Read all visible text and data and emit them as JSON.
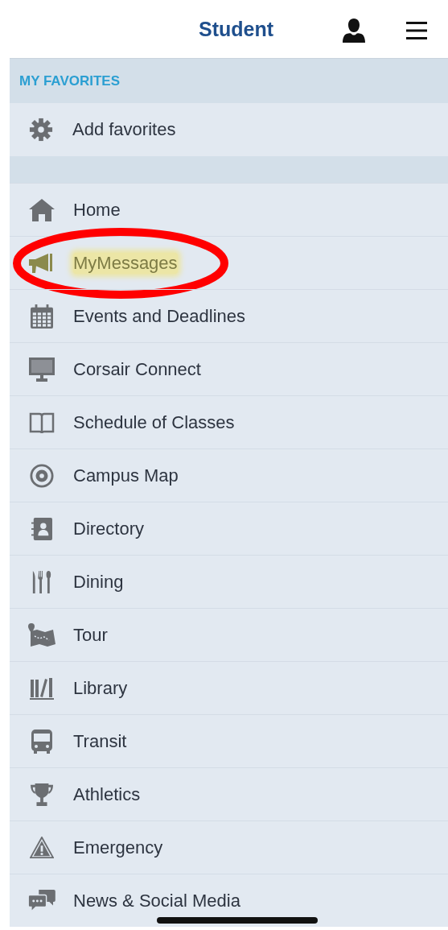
{
  "header": {
    "title": "Student"
  },
  "favorites": {
    "heading": "MY FAVORITES",
    "items": [
      {
        "label": "Add favorites"
      }
    ]
  },
  "menu": [
    {
      "label": "Home",
      "highlighted": false
    },
    {
      "label": "MyMessages",
      "highlighted": true
    },
    {
      "label": "Events and Deadlines",
      "highlighted": false
    },
    {
      "label": "Corsair Connect",
      "highlighted": false
    },
    {
      "label": "Schedule of Classes",
      "highlighted": false
    },
    {
      "label": "Campus Map",
      "highlighted": false
    },
    {
      "label": "Directory",
      "highlighted": false
    },
    {
      "label": "Dining",
      "highlighted": false
    },
    {
      "label": "Tour",
      "highlighted": false
    },
    {
      "label": "Library",
      "highlighted": false
    },
    {
      "label": "Transit",
      "highlighted": false
    },
    {
      "label": "Athletics",
      "highlighted": false
    },
    {
      "label": "Emergency",
      "highlighted": false
    },
    {
      "label": "News & Social Media",
      "highlighted": false
    }
  ]
}
